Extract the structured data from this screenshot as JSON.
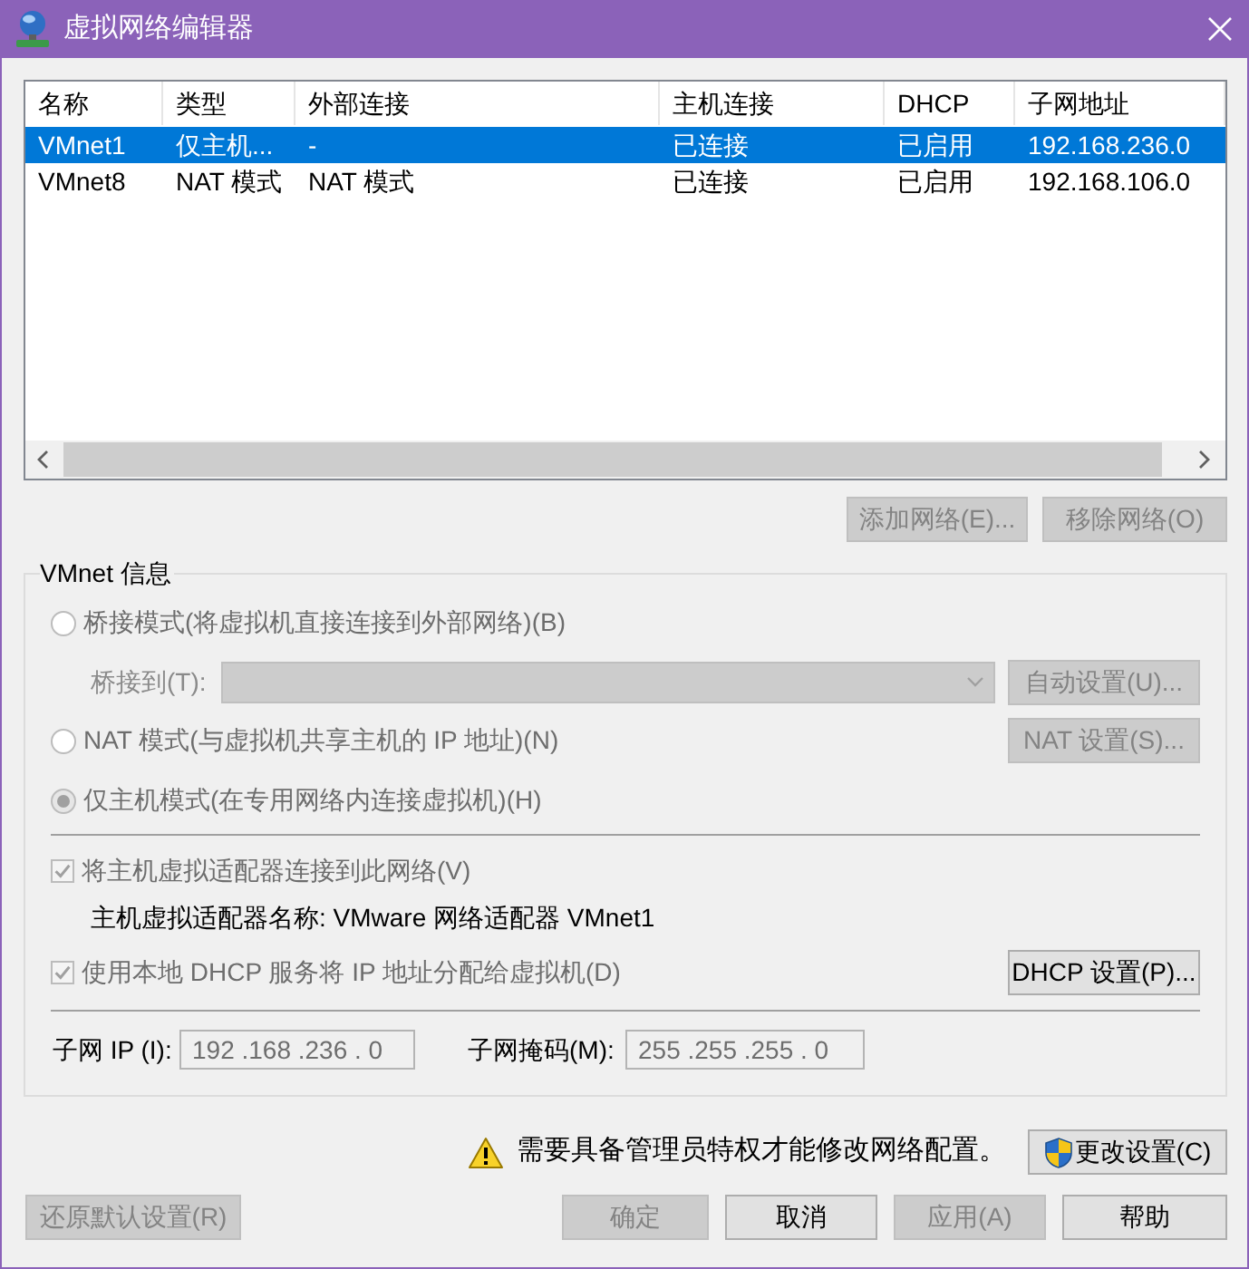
{
  "window": {
    "title": "虚拟网络编辑器"
  },
  "network_table": {
    "columns": [
      "名称",
      "类型",
      "外部连接",
      "主机连接",
      "DHCP",
      "子网地址"
    ],
    "rows": [
      {
        "cells": [
          "VMnet1",
          "仅主机...",
          "-",
          "已连接",
          "已启用",
          "192.168.236.0"
        ],
        "selected": true
      },
      {
        "cells": [
          "VMnet8",
          "NAT 模式",
          "NAT 模式",
          "已连接",
          "已启用",
          "192.168.106.0"
        ],
        "selected": false
      }
    ]
  },
  "list_buttons": [
    {
      "label": "添加网络(E)...",
      "disabled": true
    },
    {
      "label": "移除网络(O)",
      "disabled": true
    }
  ],
  "vmnet_info": {
    "title": "VMnet 信息",
    "modes": [
      {
        "label": "桥接模式(将虚拟机直接连接到外部网络)(B)",
        "selected": false,
        "disabled": true,
        "bridge_to": {
          "label": "桥接到(T):",
          "disabled": true,
          "button": {
            "label": "自动设置(U)...",
            "disabled": true
          }
        }
      },
      {
        "label": "NAT 模式(与虚拟机共享主机的 IP 地址)(N)",
        "selected": false,
        "disabled": true,
        "button": {
          "label": "NAT 设置(S)...",
          "disabled": true
        }
      },
      {
        "label": "仅主机模式(在专用网络内连接虚拟机)(H)",
        "selected": true,
        "disabled": true
      }
    ],
    "connect_adapter": {
      "label": "将主机虚拟适配器连接到此网络(V)",
      "checked": true,
      "disabled": true
    },
    "adapter_name": "主机虚拟适配器名称: VMware 网络适配器 VMnet1",
    "dhcp": {
      "label": "使用本地 DHCP 服务将 IP 地址分配给虚拟机(D)",
      "checked": true,
      "disabled": true,
      "button": {
        "label": "DHCP 设置(P)...",
        "disabled": false
      }
    },
    "subnet_ip": {
      "label": "子网 IP (I):",
      "value": "192 .168 .236 . 0",
      "disabled": true
    },
    "subnet_mask": {
      "label": "子网掩码(M):",
      "value": "255 .255 .255 . 0",
      "disabled": true
    }
  },
  "notice": {
    "text": "需要具备管理员特权才能修改网络配置。",
    "button": {
      "label": "更改设置(C)",
      "disabled": false
    }
  },
  "restore_button": {
    "label": "还原默认设置(R)",
    "disabled": true
  },
  "dialog_buttons": [
    {
      "label": "确定",
      "disabled": true
    },
    {
      "label": "取消",
      "disabled": false
    },
    {
      "label": "应用(A)",
      "disabled": true
    },
    {
      "label": "帮助",
      "disabled": false
    }
  ]
}
